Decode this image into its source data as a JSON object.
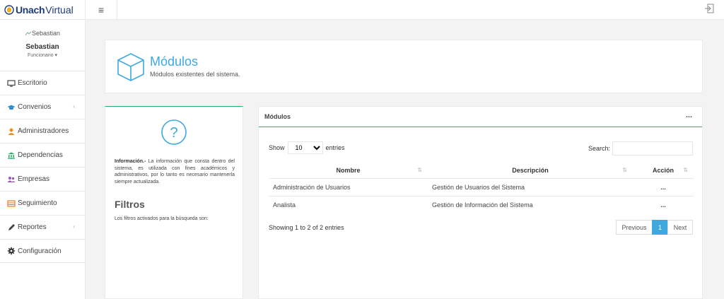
{
  "brand": {
    "bold": "Unach",
    "light": "Virtual"
  },
  "profile": {
    "avatar_alt": "Sebastian",
    "name": "Sebastian",
    "role": "Funcionario ▾"
  },
  "nav": [
    {
      "label": "Escritorio",
      "icon": "desktop-icon",
      "has_children": false
    },
    {
      "label": "Convenios",
      "icon": "graduation-cap-icon",
      "has_children": true
    },
    {
      "label": "Administradores",
      "icon": "user-icon",
      "has_children": false
    },
    {
      "label": "Dependencias",
      "icon": "bank-icon",
      "has_children": false
    },
    {
      "label": "Empresas",
      "icon": "users-icon",
      "has_children": false
    },
    {
      "label": "Seguimiento",
      "icon": "list-icon",
      "has_children": false
    },
    {
      "label": "Reportes",
      "icon": "pencil-icon",
      "has_children": true
    },
    {
      "label": "Configuración",
      "icon": "gear-icon",
      "has_children": false
    }
  ],
  "header": {
    "title": "Módulos",
    "subtitle": "Módulos existentes del sistema."
  },
  "info": {
    "lead": "Información.-",
    "text": " La información que consta dentro del sistema, es utilizada con fines académicos y administrativos, por lo tanto es necesario mantenerla siempre actualizada.",
    "filters_title": "Filtros",
    "filters_text": "Los filtros activados para la búsqueda son:"
  },
  "modules": {
    "panel_title": "Módulos",
    "menu": "...",
    "show_label": "Show",
    "entries_value": "10",
    "entries_label": "entries",
    "search_label": "Search:",
    "search_value": "",
    "columns": [
      "Nombre",
      "Descripción",
      "Acción"
    ],
    "rows": [
      {
        "nombre": "Administración de Usuarios",
        "descripcion": "Gestión de Usuarios del Sistema",
        "accion": "..."
      },
      {
        "nombre": "Analista",
        "descripcion": "Gestión de Información del Sistema",
        "accion": "..."
      }
    ],
    "showing": "Showing 1 to 2 of 2 entries",
    "pager": {
      "previous": "Previous",
      "page": "1",
      "next": "Next"
    }
  },
  "colors": {
    "accent": "#3fa9dd",
    "brand": "#1f3c78",
    "success_line": "#27ae60"
  }
}
